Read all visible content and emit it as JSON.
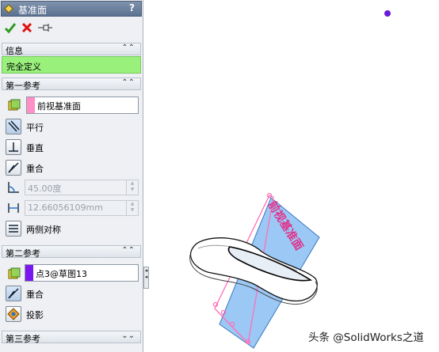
{
  "panel": {
    "title": "基准面",
    "help": "?",
    "icons": {
      "title": "plane-icon",
      "ok": "check-icon",
      "cancel": "cross-icon",
      "pin": "pushpin-icon"
    }
  },
  "info": {
    "header": "信息",
    "status": "完全定义",
    "status_color": "#99f07b"
  },
  "ref1": {
    "header": "第一参考",
    "selection": "前视基准面",
    "swatch_color": "#ff8fc7",
    "options": {
      "parallel": "平行",
      "perpendicular": "垂直",
      "coincident": "重合"
    },
    "angle_value": "45.00度",
    "distance_value": "12.66056109mm",
    "symmetric": "两侧对称"
  },
  "ref2": {
    "header": "第二参考",
    "selection": "点3@草图13",
    "swatch_color": "#7a16f0",
    "options": {
      "coincident": "重合",
      "projection": "投影"
    }
  },
  "ref3": {
    "header": "第三参考"
  },
  "viewport": {
    "plane_label": "前视基准面",
    "plane_color": "#7ab6f0",
    "point_color": "#6a1ad6"
  },
  "watermark": "头条 @SolidWorks之道"
}
